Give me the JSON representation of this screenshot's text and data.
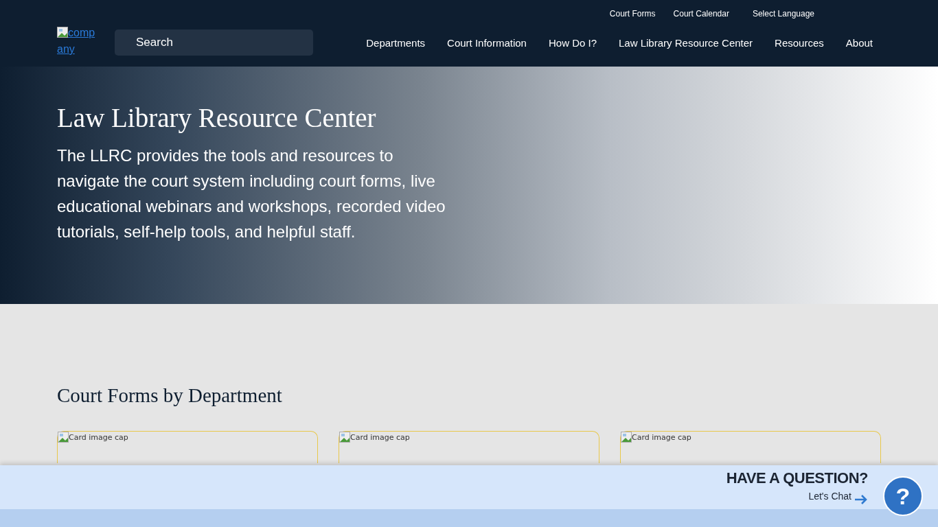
{
  "header": {
    "utility_links": [
      "Court Forms",
      "Court Calendar",
      "Select Language"
    ],
    "logo_alt": "company",
    "search": {
      "placeholder": "Search"
    },
    "nav": [
      "Departments",
      "Court Information",
      "How Do I?",
      "Law Library Resource Center",
      "Resources",
      "About"
    ]
  },
  "hero": {
    "title": "Law Library Resource Center",
    "text": "The LLRC provides the tools and resources to navigate the court system including court forms, live educational webinars and workshops, recorded video tutorials, self-help tools, and helpful staff."
  },
  "section": {
    "title": "Court Forms by Department",
    "cards": [
      {
        "image_alt": "Card image cap"
      },
      {
        "image_alt": "Card image cap"
      },
      {
        "image_alt": "Card image cap"
      }
    ]
  },
  "chat": {
    "title": "HAVE A QUESTION?",
    "link": "Let's Chat",
    "bubble": "?"
  }
}
